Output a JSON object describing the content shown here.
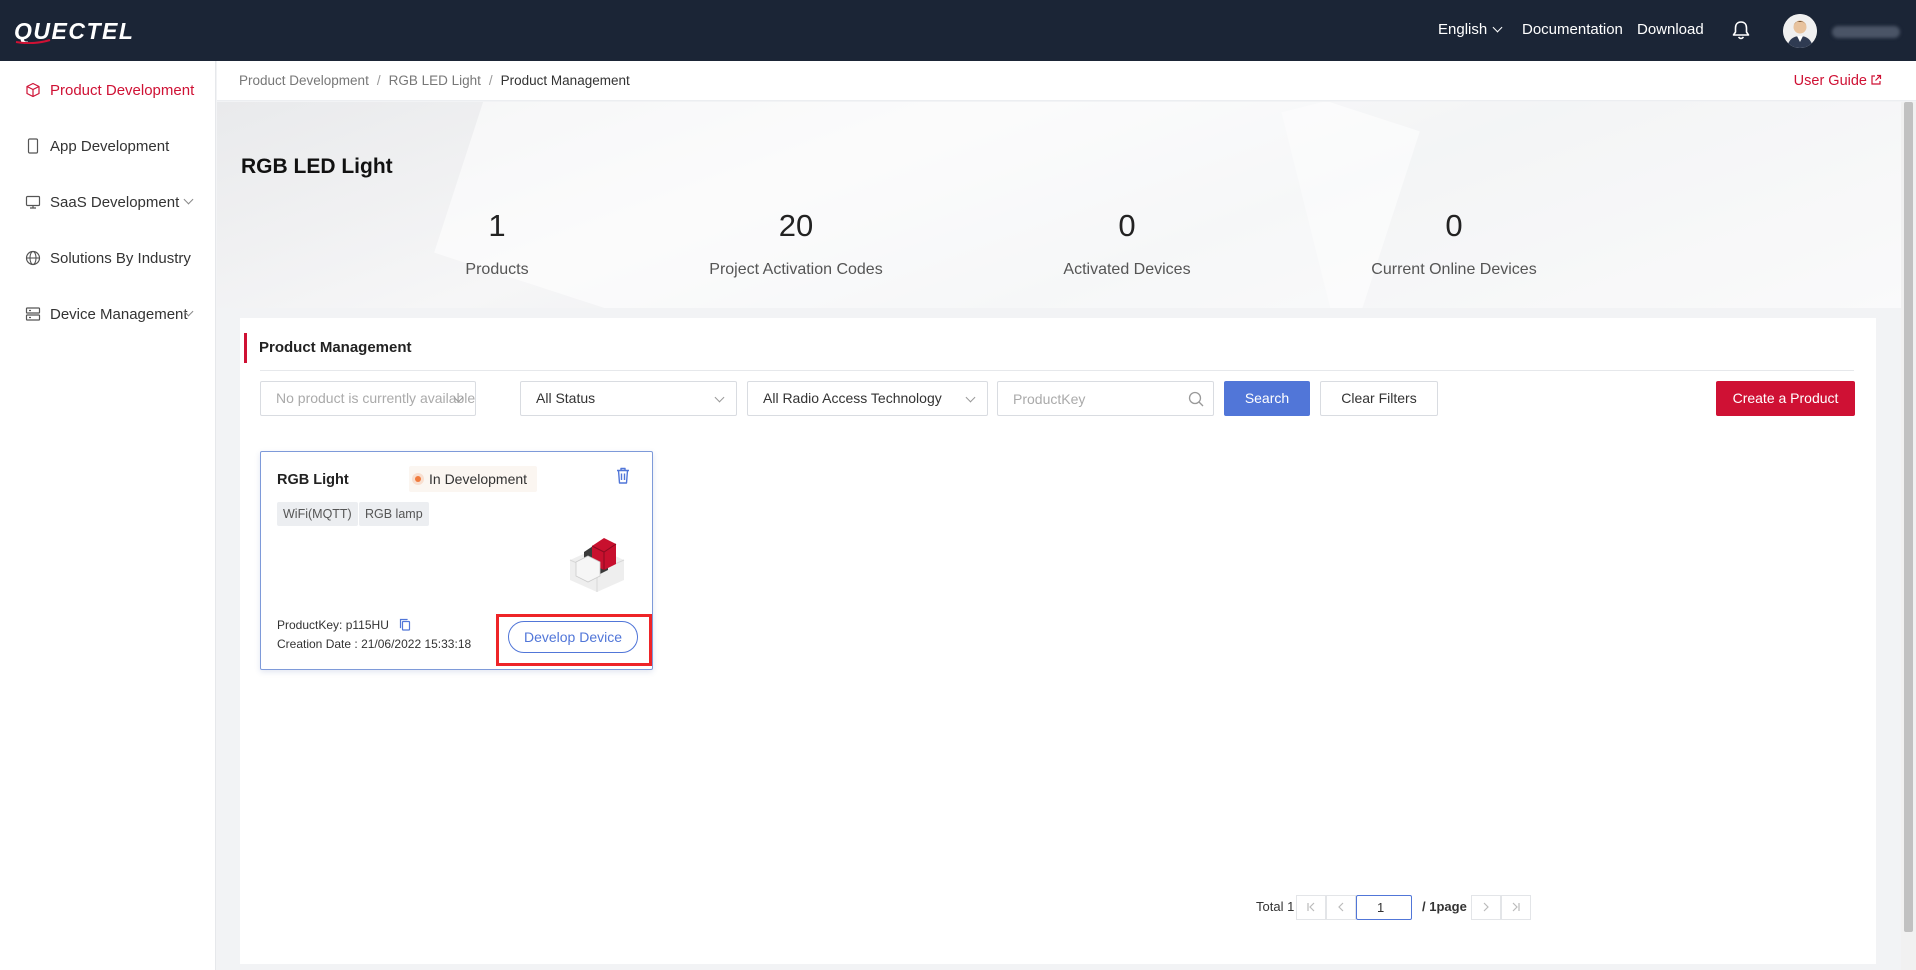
{
  "brand": {
    "logo_text": "QUECTEL",
    "accent": "#cf1134",
    "nav_bg": "#1b2536",
    "primary_blue": "#5176d8"
  },
  "topnav": {
    "language": "English",
    "documentation": "Documentation",
    "download": "Download",
    "bell_icon": "bell-icon",
    "avatar_icon": "user-avatar"
  },
  "sidebar": {
    "items": [
      {
        "label": "Product Development",
        "icon": "cube-icon",
        "active": true,
        "expandable": false
      },
      {
        "label": "App Development",
        "icon": "phone-icon",
        "active": false,
        "expandable": false
      },
      {
        "label": "SaaS Development",
        "icon": "monitor-icon",
        "active": false,
        "expandable": true
      },
      {
        "label": "Solutions By Industry",
        "icon": "globe-icon",
        "active": false,
        "expandable": false
      },
      {
        "label": "Device Management",
        "icon": "server-icon",
        "active": false,
        "expandable": true
      }
    ]
  },
  "breadcrumb": [
    "Product Development",
    "RGB LED Light",
    "Product Management"
  ],
  "user_guide": "User Guide",
  "hero": {
    "title": "RGB LED Light",
    "stats": [
      {
        "value": "1",
        "label": "Products"
      },
      {
        "value": "20",
        "label": "Project Activation Codes"
      },
      {
        "value": "0",
        "label": "Activated Devices"
      },
      {
        "value": "0",
        "label": "Current Online Devices"
      }
    ]
  },
  "product_management": {
    "heading": "Product Management",
    "filters": {
      "product_select_placeholder": "No product is currently available.",
      "status_select": "All Status",
      "rat_select": "All Radio Access Technology",
      "productkey_placeholder": "ProductKey"
    },
    "buttons": {
      "search": "Search",
      "clear": "Clear Filters",
      "create": "Create a Product"
    },
    "cards": [
      {
        "name": "RGB Light",
        "status": "In Development",
        "tags": [
          "WiFi(MQTT)",
          "RGB lamp"
        ],
        "product_key_label": "ProductKey:",
        "product_key": "p115HU",
        "creation_date_label": "Creation Date :",
        "creation_date": "21/06/2022 15:33:18",
        "action": "Develop Device"
      }
    ]
  },
  "pagination": {
    "total_label": "Total 1",
    "page_value": "1",
    "of_label": "/ 1page"
  }
}
